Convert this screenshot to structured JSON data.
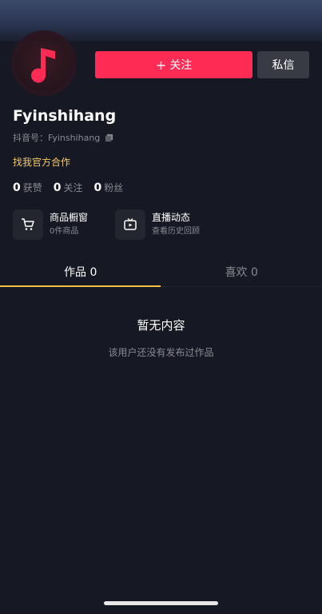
{
  "profile": {
    "username": "Fyinshihang",
    "douyin_id_label": "抖音号：",
    "douyin_id": "Fyinshihang",
    "cooperation_text": "找我官方合作"
  },
  "actions": {
    "follow_plus": "+",
    "follow_label": "关注",
    "message_label": "私信"
  },
  "stats": [
    {
      "value": "0",
      "label": "获赞"
    },
    {
      "value": "0",
      "label": "关注"
    },
    {
      "value": "0",
      "label": "粉丝"
    }
  ],
  "features": [
    {
      "title": "商品橱窗",
      "subtitle": "0件商品",
      "icon": "cart-icon"
    },
    {
      "title": "直播动态",
      "subtitle": "查看历史回顾",
      "icon": "tv-play-icon"
    }
  ],
  "tabs": [
    {
      "label": "作品 0",
      "active": true
    },
    {
      "label": "喜欢 0",
      "active": false
    }
  ],
  "empty_state": {
    "title": "暂无内容",
    "subtitle": "该用户还没有发布过作品"
  },
  "colors": {
    "background": "#161823",
    "accent_red": "#fe2c55",
    "gold": "#f6c96b",
    "tab_indicator": "#f5c242",
    "muted_text": "#8a8b91"
  }
}
